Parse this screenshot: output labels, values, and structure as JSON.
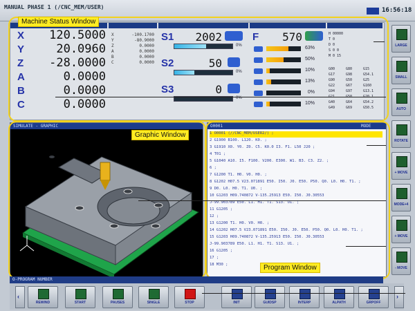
{
  "topbar": {
    "title": "MANUAL PHASE 1 (/CNC_MEM/USER)",
    "time": "16:56:18"
  },
  "callouts": {
    "status": "Machine Status Window",
    "graphic": "Graphic Window",
    "program": "Program Window"
  },
  "axes": [
    {
      "letter": "X",
      "value": "120.5000"
    },
    {
      "letter": "Y",
      "value": "20.0960"
    },
    {
      "letter": "Z",
      "value": "-28.0000"
    },
    {
      "letter": "A",
      "value": "0.0000"
    },
    {
      "letter": "B",
      "value": "0.0000"
    },
    {
      "letter": "C",
      "value": "0.0000"
    }
  ],
  "small_axes": [
    {
      "letter": "X",
      "value": "-100.1700"
    },
    {
      "letter": "Y",
      "value": "-80.9000"
    },
    {
      "letter": "Z",
      "value": "0.0000"
    },
    {
      "letter": "A",
      "value": "0.0000"
    },
    {
      "letter": "B",
      "value": "0.0000"
    },
    {
      "letter": "C",
      "value": "0.0000"
    }
  ],
  "spindles": [
    {
      "letter": "S1",
      "value": "2002",
      "pct": "0%",
      "load": 0.55
    },
    {
      "letter": "S2",
      "value": "50",
      "pct": "0%",
      "load": 0.35
    },
    {
      "letter": "S3",
      "value": "0",
      "pct": "0%",
      "load": 0.0
    }
  ],
  "feed": {
    "letter": "F",
    "value": "570"
  },
  "overrides": [
    {
      "pct": "63%",
      "level": 0.63
    },
    {
      "pct": "50%",
      "level": 0.5
    },
    {
      "pct": "10%",
      "level": 0.1
    },
    {
      "pct": "13%",
      "level": 0.13
    },
    {
      "pct": "0%",
      "level": 0.0
    },
    {
      "pct": "10%",
      "level": 0.1
    }
  ],
  "modal": {
    "header": [
      "H 00000",
      "T 0",
      "D 0",
      "S 0 0",
      "M 0 15"
    ],
    "gcodes": [
      "G00",
      "G80",
      "G15",
      "G17",
      "G98",
      "G54.1",
      "G90",
      "G50",
      "G25",
      "G22",
      "G67",
      "G160",
      "G94",
      "G97",
      "G13.1",
      "G21",
      "G50",
      "G20.1",
      "G40",
      "G64",
      "G54.2",
      "G49",
      "G69",
      "G50.5"
    ]
  },
  "side_buttons": [
    "LARGE",
    "SMALL",
    "AUTO",
    "ROTATE",
    "+ MOVE",
    "MODE+4",
    "+ MOVE",
    "- MOVE"
  ],
  "graphic": {
    "header": "SIMULATE - GRAPHIC"
  },
  "program": {
    "header": "O0001",
    "header_right": "MODE",
    "lines": [
      "1 O0001 (//CNC_MEM/USER2/) ;",
      "2 G1900 B100. L120. K0. ;",
      "3 G1910 X0. Y0. Z0. C5. K0.0 I3. F1. L50 J20 ;",
      "4 T01 ;",
      "5 G1040 A10. I5. F100. V200. E300. W1. B3. C3. Z2. ;",
      "6 ;",
      "7 G1200 T1. H0. V0. H0. ;",
      "8 G1202 H07.5 V23.071891 E50. I50. J0. E50. P50. Q0. L0. H0. T1. ;",
      "9 D0. L0. H0. T1. U0. ;",
      "10 G1203 H09.740872 V-135.25913 E50. I50. J0.30553",
      "   J-99.903789 E50. L1. H1. T1. S13. U1. ;",
      "11 G1205 ;",
      "12 ;",
      "13 G1200 T1. H0. V0. H0. ;",
      "14 G1202 H07.5 V23.071891 E50. I50. J0. E50. P50. Q0. L0. H0. T1. ;",
      "15 G1203 H09.740872 V-135.25913 E50. I50. J0.30553",
      "   J-99.903789 E50. L1. H1. T1. S13. U1. ;",
      "16 G1205 ;",
      "17 ;",
      "18 M30 ;"
    ]
  },
  "program_number_bar": "O-PROGRAM NUMBER",
  "bottom_buttons": [
    {
      "label": "REWIND",
      "kind": "green"
    },
    {
      "label": "START",
      "kind": "green"
    },
    {
      "label": "PAUSES",
      "kind": "green"
    },
    {
      "label": "SINGLE",
      "kind": "green"
    },
    {
      "label": "STOP",
      "kind": "stop"
    },
    {
      "label": "INIT",
      "kind": "blue"
    },
    {
      "label": "GUIDSP",
      "kind": "blue"
    },
    {
      "label": "INTERP",
      "kind": "blue"
    },
    {
      "label": "ALPATH",
      "kind": "blue"
    },
    {
      "label": "GRPOFF",
      "kind": "blue"
    }
  ],
  "colors": {
    "callout": "#ffec22",
    "header": "#1c3b8c",
    "axis_letter": "#2533a8"
  }
}
